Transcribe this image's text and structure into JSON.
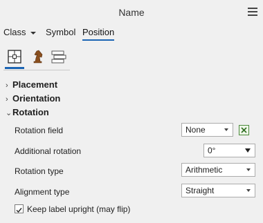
{
  "header": {
    "title": "Name",
    "menu_icon": "hamburger-icon"
  },
  "tabs": [
    {
      "label": "Class"
    },
    {
      "label": "Symbol"
    },
    {
      "label": "Position"
    }
  ],
  "icon_tabs": [
    "position-placement-icon",
    "chess-knight-icon",
    "stacked-labels-icon"
  ],
  "sections": {
    "placement": "Placement",
    "orientation": "Orientation",
    "rotation": "Rotation"
  },
  "rotation": {
    "field_label": "Rotation field",
    "field_value": "None",
    "additional_label": "Additional rotation",
    "additional_value": "0°",
    "type_label": "Rotation type",
    "type_value": "Arithmetic",
    "alignment_label": "Alignment type",
    "alignment_value": "Straight",
    "upright_label": "Keep label upright (may flip)",
    "upright_checked": true
  },
  "colors": {
    "accent": "#1a64b4",
    "expression_green": "#4a8a3a"
  }
}
